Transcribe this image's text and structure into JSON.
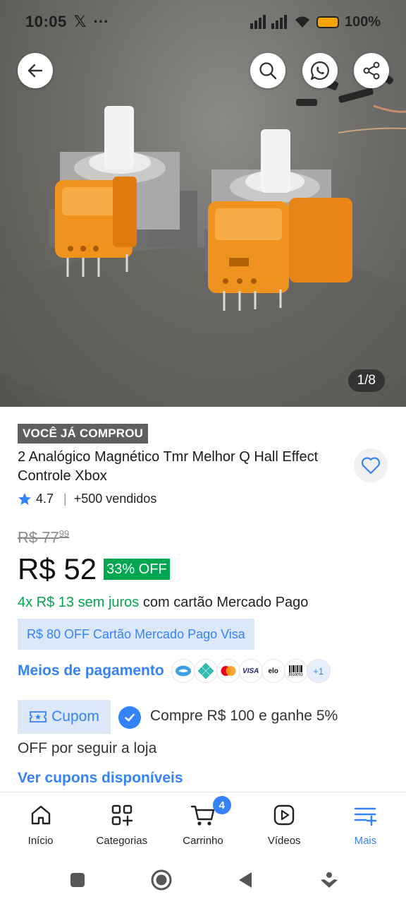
{
  "status_bar": {
    "time": "10:05",
    "x_glyph": "𝕏",
    "dots": "···",
    "battery": "100%"
  },
  "gallery": {
    "counter": "1/8"
  },
  "product": {
    "badge": "VOCÊ JÁ COMPROU",
    "title": "2 Analógico Magnético Tmr Melhor Q Hall Effect Controle Xbox",
    "rating": "4.7",
    "sold": "+500 vendidos",
    "old_price_int": "R$ 77",
    "old_price_cents": "99",
    "price": "R$ 52",
    "discount": "33% OFF",
    "installments_green": "4x R$ 13 sem juros",
    "installments_rest": " com cartão Mercado Pago",
    "promo": "R$ 80 OFF Cartão Mercado Pago Visa",
    "payment_label": "Meios de pagamento",
    "payment_methods": [
      "mercado-pago",
      "pix",
      "mastercard",
      "VISA",
      "elo",
      "Boleto",
      "+1"
    ],
    "coupon_label": "Cupom",
    "coupon_text_line1": "Compre R$ 100 e ganhe 5%",
    "coupon_text_line2": "OFF por seguir a loja",
    "coupons_link": "Ver cupons disponíveis"
  },
  "bottom_nav": {
    "items": [
      {
        "label": "Início",
        "icon": "home-icon"
      },
      {
        "label": "Categorias",
        "icon": "categories-icon"
      },
      {
        "label": "Carrinho",
        "icon": "cart-icon",
        "badge": "4"
      },
      {
        "label": "Vídeos",
        "icon": "video-icon"
      },
      {
        "label": "Mais",
        "icon": "menu-plus-icon",
        "active": true
      }
    ]
  },
  "colors": {
    "brand_blue": "#3483fa",
    "green": "#00a650",
    "badge_gray": "#5f5f5f"
  }
}
